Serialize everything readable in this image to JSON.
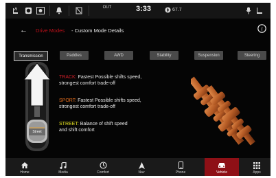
{
  "status_bar": {
    "outside_temp_label": "OUT",
    "clock": "3:33",
    "compass_reading": "67.7"
  },
  "header": {
    "breadcrumb_parent": "Drive Modes",
    "breadcrumb_separator": " - ",
    "title": "Custom Mode Details"
  },
  "tabs": [
    {
      "label": "Transmission",
      "active": true
    },
    {
      "label": "Paddles",
      "active": false
    },
    {
      "label": "AWD",
      "active": false
    },
    {
      "label": "Stability",
      "active": false
    },
    {
      "label": "Suspension",
      "active": false
    },
    {
      "label": "Steering",
      "active": false
    }
  ],
  "modes": [
    {
      "name": "TRACK:",
      "color": "#d41e28",
      "desc_line1": "Fastest Possible shifts speed,",
      "desc_line2": "strongest comfort trade-off"
    },
    {
      "name": "SPORT:",
      "color": "#e76f1e",
      "desc_line1": "Fastest Possible shifts speed,",
      "desc_line2": "strongest comfort trade-off"
    },
    {
      "name": "STREET:",
      "color": "#e3e021",
      "desc_line1": "Balance of shift speed",
      "desc_line2": "and shift comfort"
    }
  ],
  "shifter": {
    "selected_label": "Street"
  },
  "nav": [
    {
      "label": "Home",
      "icon": "home-icon",
      "active": false
    },
    {
      "label": "Media",
      "icon": "music-note-icon",
      "active": false
    },
    {
      "label": "Comfort",
      "icon": "comfort-icon",
      "active": false
    },
    {
      "label": "Nav",
      "icon": "navigation-arrow-icon",
      "active": false
    },
    {
      "label": "Phone",
      "icon": "phone-icon",
      "active": false
    },
    {
      "label": "Vehicle",
      "icon": "vehicle-icon",
      "active": true
    },
    {
      "label": "Apps",
      "icon": "apps-grid-icon",
      "active": false
    }
  ],
  "colors": {
    "accent_red": "#c0101a",
    "nav_active": "#8e1016",
    "gear_copper": "#b9652e"
  }
}
